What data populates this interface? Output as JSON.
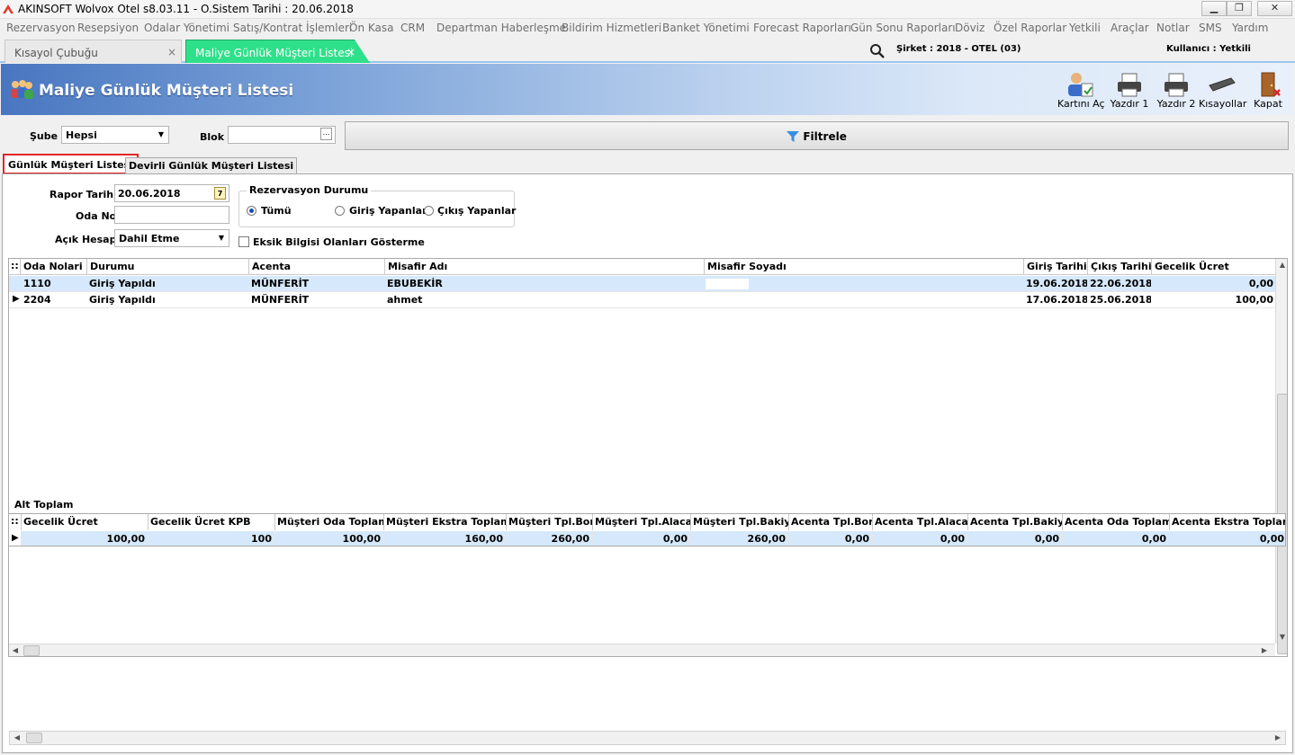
{
  "window": {
    "title": "AKINSOFT Wolvox Otel s8.03.11 - O.Sistem Tarihi : 20.06.2018"
  },
  "menu": [
    "Rezervasyon",
    "Resepsiyon",
    "Odalar Yönetimi",
    "Satış/Kontrat İşlemleri",
    "Ön Kasa",
    "CRM",
    "Departman Haberleşme",
    "Bildirim Hizmetleri",
    "Banket Yönetimi",
    "Forecast Raporları",
    "Gün Sonu Raporları",
    "Döviz",
    "Özel Raporlar",
    "Yetkili",
    "Araçlar",
    "Notlar",
    "SMS",
    "Yardım"
  ],
  "tabs": {
    "kisayol": "Kısayol Çubuğu",
    "maliye": "Maliye Günlük Müşteri Listesi",
    "close": "×"
  },
  "status": {
    "sirket": "Şirket : 2018 - OTEL (03)",
    "kullanici": "Kullanıcı : Yetkili"
  },
  "header": {
    "title": "Maliye Günlük Müşteri Listesi"
  },
  "toolbar": {
    "kartini_ac": "Kartını Aç",
    "yazdir1": "Yazdır 1",
    "yazdir2": "Yazdır 2",
    "kisayollar": "Kısayollar",
    "kapat": "Kapat"
  },
  "filters": {
    "sube_label": "Şube",
    "sube_value": "Hepsi",
    "blok_label": "Blok",
    "blok_btn": "...",
    "filtrele": "Filtrele"
  },
  "subtabs": {
    "gunluk": "Günlük Müşteri Listesi",
    "devirli": "Devirli Günlük Müşteri Listesi"
  },
  "form": {
    "rapor_tarihi_label": "Rapor Tarihi",
    "rapor_tarihi": "20.06.2018",
    "cal_day": "7",
    "oda_no_label": "Oda No",
    "acik_hesap_label": "Açık Hesap",
    "acik_hesap_value": "Dahil Etme",
    "rez_durumu_title": "Rezervasyon Durumu",
    "radio_tumu": "Tümü",
    "radio_giris": "Giriş Yapanlar",
    "radio_cikis": "Çıkış Yapanlar",
    "eksik_bilgi": "Eksik Bilgisi Olanları Gösterme"
  },
  "grid": {
    "columns": [
      "Oda Nolari",
      "Durumu",
      "Acenta",
      "Misafir Adı",
      "Misafir Soyadı",
      "Giriş Tarihi",
      "Çıkış Tarihi",
      "Gecelik Ücret"
    ],
    "rows": [
      {
        "oda": "1110",
        "durum": "Giriş Yapıldı",
        "acenta": "MÜNFERİT",
        "ad": "EBUBEKİR",
        "soyad": "",
        "giris": "19.06.2018 (",
        "cikis": "22.06.2018 :",
        "ucret": "0,00"
      },
      {
        "oda": "2204",
        "durum": "Giriş Yapıldı",
        "acenta": "MÜNFERİT",
        "ad": "ahmet",
        "soyad": "",
        "giris": "17.06.2018 :",
        "cikis": "25.06.2018 :",
        "ucret": "100,00"
      }
    ]
  },
  "summary": {
    "label": "Alt Toplam",
    "columns": [
      "Gecelik Ücret",
      "Gecelik Ücret KPB",
      "Müşteri Oda Toplamı",
      "Müşteri Ekstra Toplamı",
      "Müşteri Tpl.Borç",
      "Müşteri Tpl.Alacak",
      "Müşteri Tpl.Bakiye",
      "Acenta Tpl.Borç",
      "Acenta Tpl.Alacak",
      "Acenta Tpl.Bakiye",
      "Acenta Oda Toplamı",
      "Acenta Ekstra Toplamı"
    ],
    "values": [
      "100,00",
      "100",
      "100,00",
      "160,00",
      "260,00",
      "0,00",
      "260,00",
      "0,00",
      "0,00",
      "0,00",
      "0,00",
      "0,00"
    ]
  }
}
